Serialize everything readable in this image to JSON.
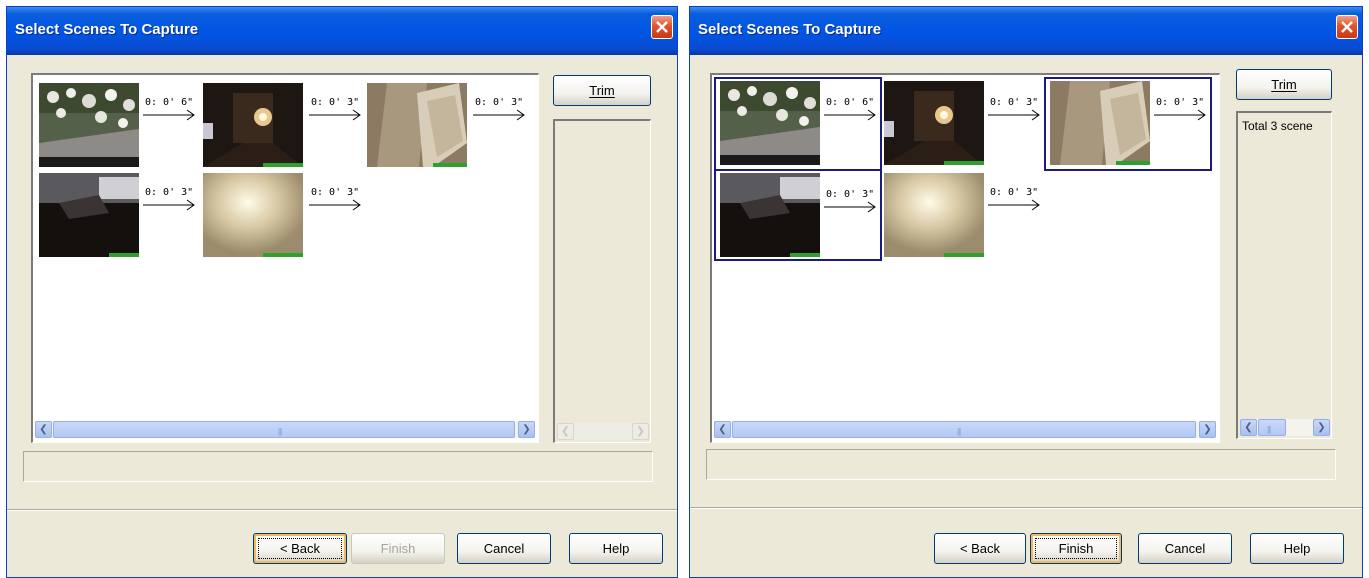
{
  "dialogs": [
    {
      "title": "Select Scenes To Capture",
      "scenes": [
        {
          "duration": "0: 0' 6\"",
          "selected": false
        },
        {
          "duration": "0: 0' 3\"",
          "selected": false
        },
        {
          "duration": "0: 0' 3\"",
          "selected": false
        },
        {
          "duration": "0: 0' 3\"",
          "selected": false
        },
        {
          "duration": "0: 0' 3\"",
          "selected": false
        }
      ],
      "trim_label": "Trim",
      "side_text": "",
      "buttons": {
        "back": "< Back",
        "finish": "Finish",
        "cancel": "Cancel",
        "help": "Help"
      },
      "finish_enabled": false
    },
    {
      "title": "Select Scenes To Capture",
      "scenes": [
        {
          "duration": "0: 0' 6\"",
          "selected": true
        },
        {
          "duration": "0: 0' 3\"",
          "selected": false
        },
        {
          "duration": "0: 0' 3\"",
          "selected": true
        },
        {
          "duration": "0: 0' 3\"",
          "selected": true
        },
        {
          "duration": "0: 0' 3\"",
          "selected": false
        }
      ],
      "trim_label": "Trim",
      "side_text": "Total  3 scene",
      "buttons": {
        "back": "< Back",
        "finish": "Finish",
        "cancel": "Cancel",
        "help": "Help"
      },
      "finish_enabled": true
    }
  ],
  "icons": {
    "close": "close-x-icon",
    "scroll_left": "scroll-left-arrow-icon",
    "scroll_right": "scroll-right-arrow-icon",
    "arrow": "right-arrow-icon"
  },
  "colors": {
    "titlebar": "#0055e4",
    "selection_border": "#1a1a80",
    "dialog_bg": "#ece9d8"
  }
}
